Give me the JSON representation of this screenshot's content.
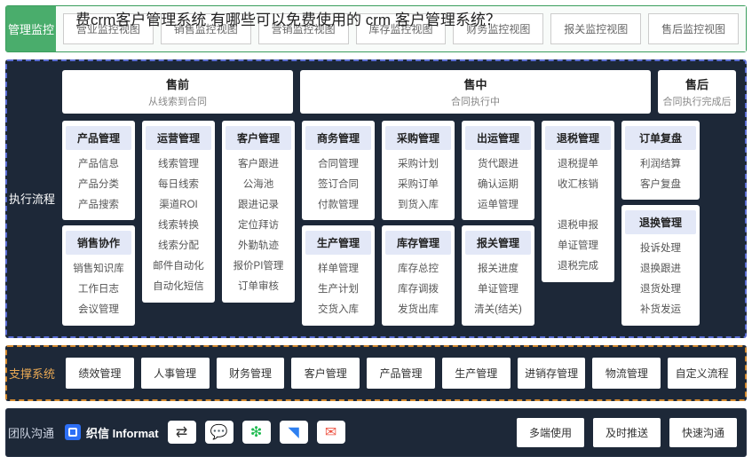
{
  "overlay_title": "费crm客户管理系统 有哪些可以免费使用的 crm 客户管理系统？",
  "sections": {
    "monitor": {
      "label": "管理监控",
      "views": [
        "营业监控视图",
        "销售监控视图",
        "营销监控视图",
        "库存监控视图",
        "财务监控视图",
        "报关监控视图",
        "售后监控视图"
      ]
    },
    "process": {
      "label": "执行流程",
      "phases": {
        "pre": {
          "title": "售前",
          "sub": "从线索到合同"
        },
        "mid": {
          "title": "售中",
          "sub": "合同执行中"
        },
        "post": {
          "title": "售后",
          "sub": "合同执行完成后"
        }
      },
      "cols": [
        {
          "w": "col-86",
          "modules": [
            {
              "head": "产品管理",
              "items": [
                "产品信息",
                "产品分类",
                "产品搜索"
              ]
            },
            {
              "head": "销售协作",
              "items": [
                "销售知识库",
                "工作日志",
                "会议管理"
              ]
            }
          ]
        },
        {
          "w": "col-86",
          "modules": [
            {
              "head": "运营管理",
              "items": [
                "线索管理",
                "每日线索",
                "渠道ROI",
                "线索转换",
                "线索分配",
                "邮件自动化",
                "自动化短信"
              ]
            }
          ]
        },
        {
          "w": "col-86",
          "modules": [
            {
              "head": "客户管理",
              "items": [
                "客户跟进",
                "公海池",
                "跟进记录",
                "定位拜访",
                "外勤轨迹",
                "报价PI管理",
                "订单审核"
              ]
            }
          ]
        },
        {
          "w": "col-86",
          "modules": [
            {
              "head": "商务管理",
              "items": [
                "合同管理",
                "签订合同",
                "付款管理"
              ]
            },
            {
              "head": "生产管理",
              "items": [
                "样单管理",
                "生产计划",
                "交货入库"
              ]
            }
          ]
        },
        {
          "w": "col-86",
          "modules": [
            {
              "head": "采购管理",
              "items": [
                "采购计划",
                "采购订单",
                "到货入库"
              ]
            },
            {
              "head": "库存管理",
              "items": [
                "库存总控",
                "库存调拨",
                "发货出库"
              ]
            }
          ]
        },
        {
          "w": "col-86",
          "modules": [
            {
              "head": "出运管理",
              "items": [
                "货代跟进",
                "确认运期",
                "运单管理"
              ]
            },
            {
              "head": "报关管理",
              "items": [
                "报关进度",
                "单证管理",
                "清关(结关)"
              ]
            }
          ]
        },
        {
          "w": "col-86",
          "modules": [
            {
              "head": "退税管理",
              "items": [
                "退税提单",
                "收汇核销",
                "",
                "退税申报",
                "单证管理",
                "退税完成"
              ]
            }
          ]
        },
        {
          "w": "col-88",
          "modules": [
            {
              "head": "订单复盘",
              "items": [
                "利润结算",
                "客户复盘"
              ]
            },
            {
              "head": "退换管理",
              "items": [
                "投诉处理",
                "退换跟进",
                "退货处理",
                "补货发运"
              ]
            }
          ]
        }
      ]
    },
    "support": {
      "label": "支撑系统",
      "items": [
        "绩效管理",
        "人事管理",
        "财务管理",
        "客户管理",
        "产品管理",
        "生产管理",
        "进销存管理",
        "物流管理",
        "自定义流程"
      ]
    },
    "comm": {
      "label": "团队沟通",
      "brand": "织信 Informat",
      "buttons": [
        "多端使用",
        "及时推送",
        "快速沟通"
      ]
    }
  }
}
